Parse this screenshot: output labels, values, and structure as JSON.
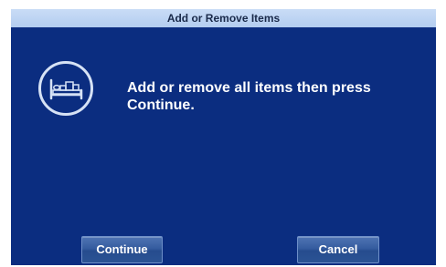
{
  "dialog": {
    "title": "Add or Remove Items",
    "message": "Add or remove all items then press Continue.",
    "icon": "bed-icon"
  },
  "buttons": {
    "continue_label": "Continue",
    "cancel_label": "Cancel"
  },
  "colors": {
    "background": "#0b2d80",
    "title_bar": "#bcd3f3",
    "button": "#355c9f",
    "text": "#ffffff"
  }
}
